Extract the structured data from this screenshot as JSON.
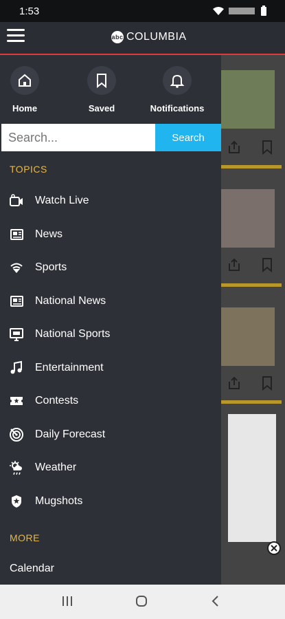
{
  "status": {
    "time": "1:53"
  },
  "header": {
    "title": "COLUMBIA",
    "abc": "abc"
  },
  "quick_actions": [
    {
      "label": "Home",
      "icon": "home-icon"
    },
    {
      "label": "Saved",
      "icon": "bookmark-icon"
    },
    {
      "label": "Notifications",
      "icon": "bell-icon"
    }
  ],
  "search": {
    "placeholder": "Search...",
    "button": "Search"
  },
  "sections": {
    "topics": "TOPICS",
    "more": "MORE"
  },
  "menu": [
    {
      "label": "Watch Live",
      "icon": "video-camera-icon"
    },
    {
      "label": "News",
      "icon": "newspaper-icon"
    },
    {
      "label": "Sports",
      "icon": "sports-icon"
    },
    {
      "label": "National News",
      "icon": "newspaper-icon"
    },
    {
      "label": "National Sports",
      "icon": "monitor-icon"
    },
    {
      "label": "Entertainment",
      "icon": "music-note-icon"
    },
    {
      "label": "Contests",
      "icon": "ticket-icon"
    },
    {
      "label": "Daily Forecast",
      "icon": "radar-icon"
    },
    {
      "label": "Weather",
      "icon": "weather-icon"
    },
    {
      "label": "Mugshots",
      "icon": "police-badge-icon"
    }
  ],
  "more_items": [
    {
      "label": "Calendar"
    }
  ],
  "colors": {
    "accent_search": "#20b5ee",
    "section": "#e6b84a",
    "drawer_bg": "#2e3038",
    "header_line": "#e03a3a"
  }
}
